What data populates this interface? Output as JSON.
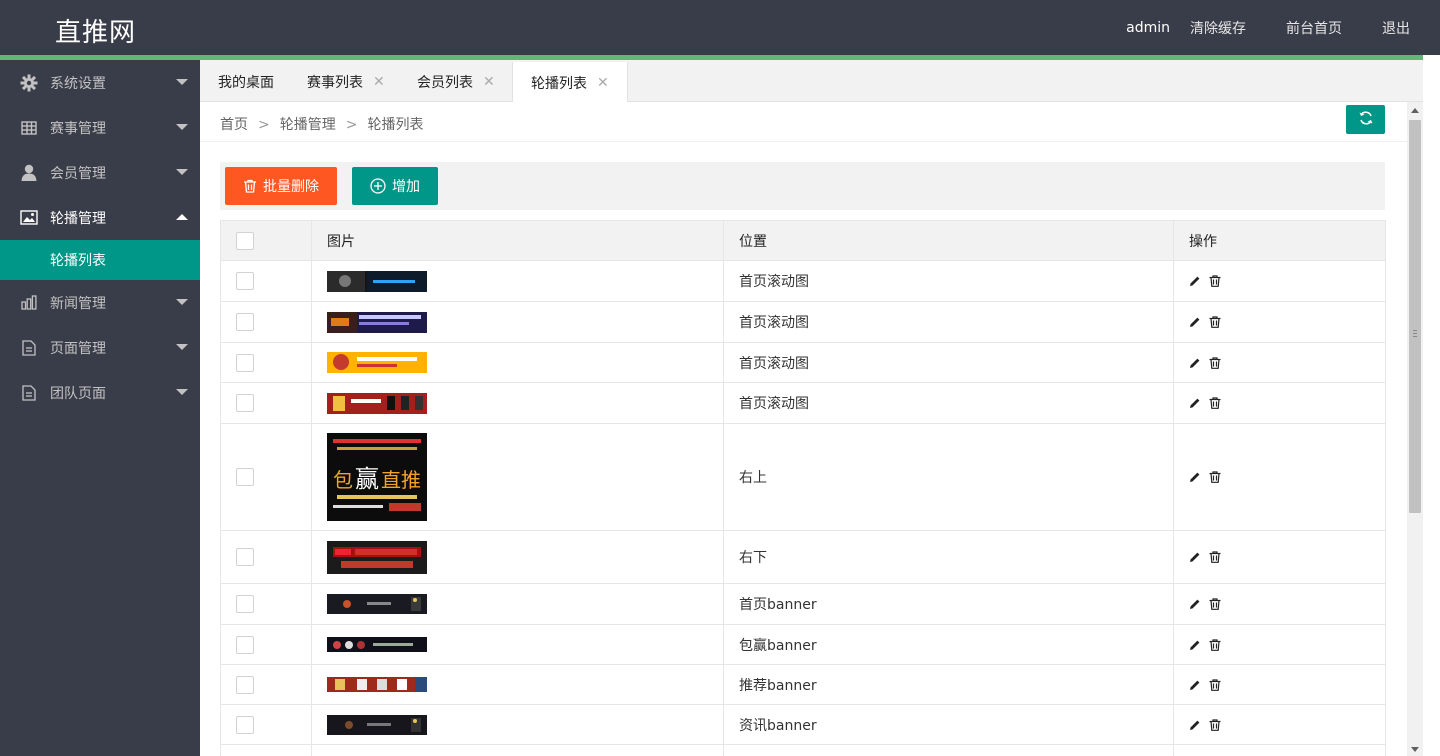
{
  "header": {
    "logo": "直推网",
    "user": "admin",
    "clear_cache": "清除缓存",
    "front_home": "前台首页",
    "logout": "退出"
  },
  "sidebar": {
    "items": [
      {
        "label": "系统设置",
        "icon": "gear-icon"
      },
      {
        "label": "赛事管理",
        "icon": "grid-icon"
      },
      {
        "label": "会员管理",
        "icon": "user-icon"
      },
      {
        "label": "轮播管理",
        "icon": "image-icon",
        "open": true
      },
      {
        "label": "新闻管理",
        "icon": "chart-icon"
      },
      {
        "label": "页面管理",
        "icon": "document-icon"
      },
      {
        "label": "团队页面",
        "icon": "document-icon"
      }
    ],
    "sub_item": "轮播列表"
  },
  "tabs": [
    {
      "label": "我的桌面",
      "closable": false
    },
    {
      "label": "赛事列表",
      "closable": true
    },
    {
      "label": "会员列表",
      "closable": true
    },
    {
      "label": "轮播列表",
      "closable": true,
      "active": true
    }
  ],
  "breadcrumb": [
    "首页",
    "轮播管理",
    "轮播列表"
  ],
  "breadcrumb_sep": ">",
  "toolbar": {
    "batch_delete": "批量删除",
    "add": "增加"
  },
  "table": {
    "columns": [
      "",
      "图片",
      "位置",
      "操作"
    ],
    "rows": [
      {
        "position": "首页滚动图",
        "thumb": "dark-wide"
      },
      {
        "position": "首页滚动图",
        "thumb": "purple-wide"
      },
      {
        "position": "首页滚动图",
        "thumb": "yellow-wide"
      },
      {
        "position": "首页滚动图",
        "thumb": "red-wide"
      },
      {
        "position": "右上",
        "thumb": "poster"
      },
      {
        "position": "右下",
        "thumb": "app-banner"
      },
      {
        "position": "首页banner",
        "thumb": "night-wide"
      },
      {
        "position": "包赢banner",
        "thumb": "crowd-wide"
      },
      {
        "position": "推荐banner",
        "thumb": "red2-wide"
      },
      {
        "position": "资讯banner",
        "thumb": "dark2-wide"
      }
    ]
  },
  "colors": {
    "header_bg": "#393d49",
    "accent": "#009688",
    "danger": "#ff5722",
    "green_line": "#5fb878"
  }
}
